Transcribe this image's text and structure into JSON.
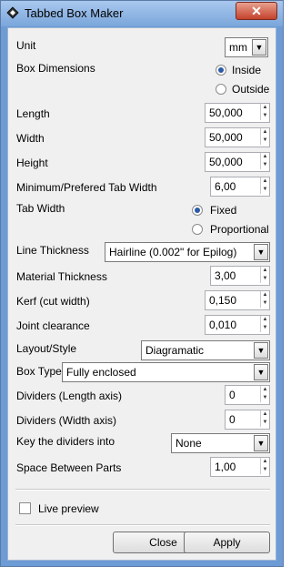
{
  "window": {
    "title": "Tabbed Box Maker",
    "close_glyph": "✕"
  },
  "unit": {
    "label": "Unit",
    "value": "mm"
  },
  "box_dimensions": {
    "label": "Box Dimensions",
    "options": [
      {
        "label": "Inside",
        "selected": true
      },
      {
        "label": "Outside",
        "selected": false
      }
    ]
  },
  "fields": {
    "length": {
      "label": "Length",
      "value": "50,000"
    },
    "width": {
      "label": "Width",
      "value": "50,000"
    },
    "height": {
      "label": "Height",
      "value": "50,000"
    },
    "min_tab_width": {
      "label": "Minimum/Prefered Tab Width",
      "value": "6,00"
    },
    "material_thickness": {
      "label": "Material Thickness",
      "value": "3,00"
    },
    "kerf": {
      "label": "Kerf (cut width)",
      "value": "0,150"
    },
    "joint_clearance": {
      "label": "Joint clearance",
      "value": "0,010"
    },
    "dividers_length": {
      "label": "Dividers (Length axis)",
      "value": "0"
    },
    "dividers_width": {
      "label": "Dividers (Width axis)",
      "value": "0"
    },
    "space_between": {
      "label": "Space Between Parts",
      "value": "1,00"
    }
  },
  "tab_width": {
    "label": "Tab Width",
    "options": [
      {
        "label": "Fixed",
        "selected": true
      },
      {
        "label": "Proportional",
        "selected": false
      }
    ]
  },
  "line_thickness": {
    "label": "Line Thickness",
    "value": "Hairline (0.002\" for Epilog)"
  },
  "layout_style": {
    "label": "Layout/Style",
    "value": "Diagramatic"
  },
  "box_type": {
    "label": "Box Type",
    "value": "Fully enclosed"
  },
  "key_dividers": {
    "label": "Key the dividers into",
    "value": "None"
  },
  "live_preview": {
    "label": "Live preview",
    "checked": false
  },
  "buttons": {
    "close": "Close",
    "apply": "Apply"
  },
  "icons": {
    "spin_up": "▲",
    "spin_down": "▼",
    "dropdown": "▼"
  }
}
